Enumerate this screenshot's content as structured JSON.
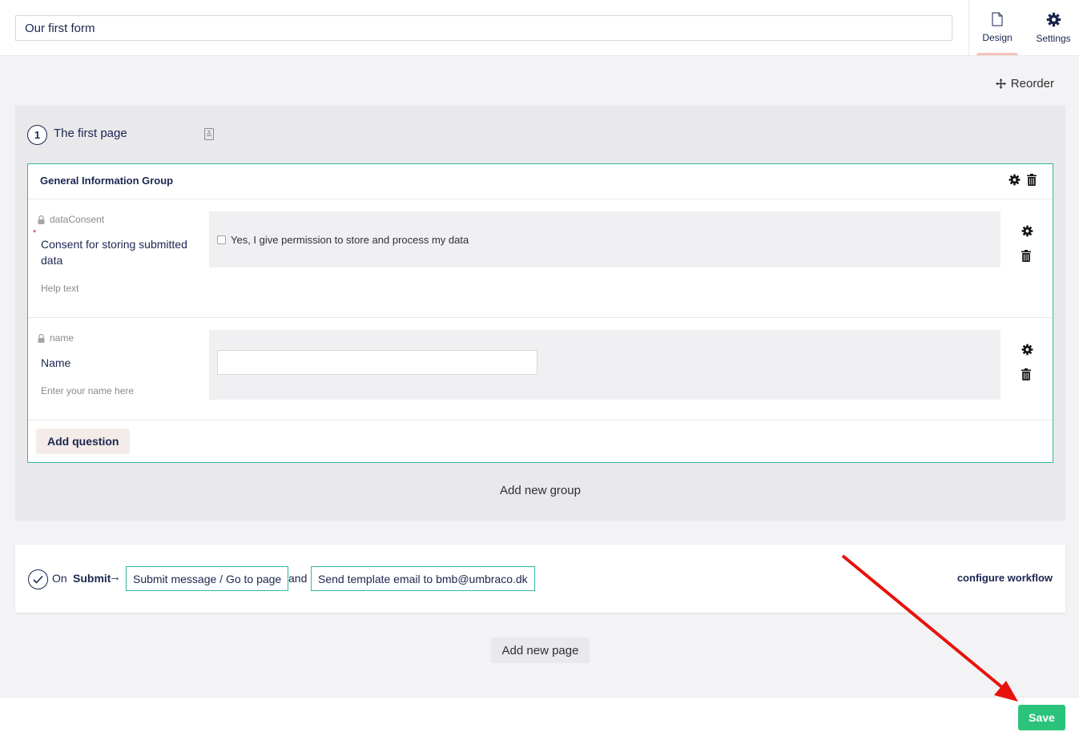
{
  "header": {
    "form_name": "Our first form",
    "tabs": [
      {
        "label": "Design",
        "icon": "document-icon",
        "active": true
      },
      {
        "label": "Settings",
        "icon": "gear-icon",
        "active": false
      }
    ]
  },
  "toolbar": {
    "reorder_label": "Reorder"
  },
  "page": {
    "number": "1",
    "title": "The first page",
    "group": {
      "title": "General Information Group",
      "questions": [
        {
          "alias": "dataConsent",
          "caption": "Consent for storing submitted data",
          "required": true,
          "help": "Help text",
          "checkbox_label": "Yes, I give permission to store and process my data"
        },
        {
          "alias": "name",
          "caption": "Name",
          "required": false,
          "help": "Enter your name here"
        }
      ],
      "add_question_label": "Add question"
    },
    "add_group_label": "Add new group"
  },
  "workflow": {
    "on_label": "On",
    "submit_label": "Submit",
    "arrow": "→",
    "step1": "Submit message / Go to page",
    "and_label": "and",
    "step2": "Send template email to bmb@umbraco.dk",
    "configure_label": "configure workflow"
  },
  "add_page_label": "Add new page",
  "footer": {
    "save_label": "Save"
  },
  "colors": {
    "accent_teal": "#35b7a0",
    "save_green": "#2bc37c",
    "navy_text": "#1b264f",
    "annotation_red": "#e8120c"
  }
}
